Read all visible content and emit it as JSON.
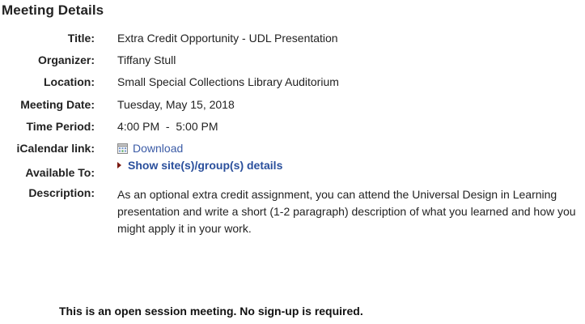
{
  "heading": "Meeting Details",
  "labels": {
    "title": "Title:",
    "organizer": "Organizer:",
    "location": "Location:",
    "meeting_date": "Meeting Date:",
    "time_period": "Time Period:",
    "icalendar": "iCalendar link:",
    "available_to": "Available To:",
    "description": "Description:"
  },
  "values": {
    "title": "Extra Credit Opportunity - UDL Presentation",
    "organizer": "Tiffany Stull",
    "location": "Small Special Collections Library Auditorium",
    "meeting_date": "Tuesday, May 15, 2018",
    "time_period": "4:00 PM  -  5:00 PM",
    "icalendar_link": "Download",
    "available_to_toggle": "Show site(s)/group(s) details",
    "description": "As an optional extra credit assignment, you can attend the Universal Design in Learning presentation and write a short (1-2 paragraph) description of what you learned and how you might apply it in your work."
  },
  "footer": "This is an open session meeting. No sign-up is required.",
  "icons": {
    "calendar": "calendar-icon",
    "expand": "expand-triangle-icon"
  },
  "colors": {
    "link": "#3b5ba6",
    "toggle": "#2a4f9c",
    "triangle": "#7a1a12"
  }
}
